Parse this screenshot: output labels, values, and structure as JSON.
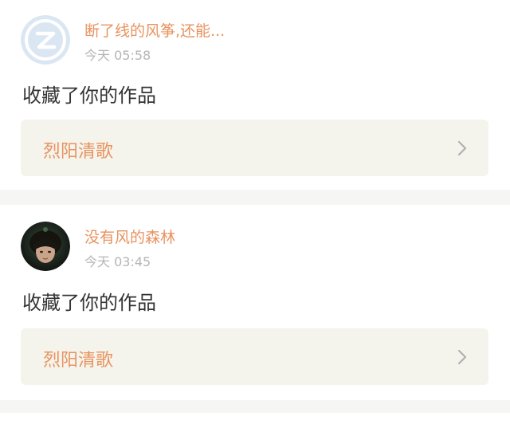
{
  "notifications": [
    {
      "username": "断了线的风筝,还能...",
      "time": "今天 05:58",
      "action": "收藏了你的作品",
      "work_title": "烈阳清歌",
      "avatar_icon": "default-z-avatar-icon"
    },
    {
      "username": "没有风的森林",
      "time": "今天 03:45",
      "action": "收藏了你的作品",
      "work_title": "烈阳清歌",
      "avatar_icon": "user-photo-avatar"
    }
  ],
  "colors": {
    "accent": "#e8935f",
    "muted": "#b5b5b5",
    "text": "#333333",
    "work_bg": "#f5f4ec",
    "separator": "#f6f6f4"
  }
}
